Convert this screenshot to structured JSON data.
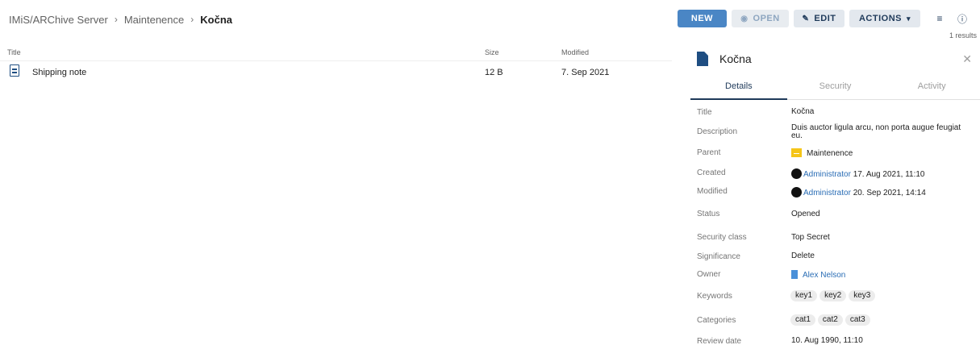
{
  "breadcrumb": {
    "items": [
      "IMiS/ARChive Server",
      "Maintenence",
      "Kočna"
    ],
    "separator": "›"
  },
  "toolbar": {
    "new_label": "NEW",
    "open_label": "OPEN",
    "edit_label": "EDIT",
    "actions_label": "ACTIONS",
    "results_text": "1 results"
  },
  "table": {
    "columns": {
      "title": "Title",
      "size": "Size",
      "modified": "Modified"
    },
    "rows": [
      {
        "title": "Shipping note",
        "size": "12 B",
        "modified": "7. Sep 2021"
      }
    ]
  },
  "panel": {
    "title": "Kočna",
    "tabs": [
      "Details",
      "Security",
      "Activity"
    ],
    "active_tab": "Details",
    "details": {
      "title_label": "Title",
      "title_value": "Kočna",
      "description_label": "Description",
      "description_value": "Duis auctor ligula arcu, non porta augue feugiat eu.",
      "parent_label": "Parent",
      "parent_value": "Maintenence",
      "created_label": "Created",
      "created_user": "Administrator",
      "created_date": "17. Aug 2021, 11:10",
      "modified_label": "Modified",
      "modified_user": "Administrator",
      "modified_date": "20. Sep 2021, 14:14",
      "status_label": "Status",
      "status_value": "Opened",
      "security_class_label": "Security class",
      "security_class_value": "Top Secret",
      "significance_label": "Significance",
      "significance_value": "Delete",
      "owner_label": "Owner",
      "owner_value": "Alex Nelson",
      "keywords_label": "Keywords",
      "keywords": [
        "key1",
        "key2",
        "key3"
      ],
      "categories_label": "Categories",
      "categories": [
        "cat1",
        "cat2",
        "cat3"
      ],
      "review_date_label": "Review date",
      "review_date_value": "10. Aug 1990, 11:10"
    }
  },
  "colors": {
    "primary": "#4a86c5",
    "navy": "#1f3a5a",
    "link": "#2a6db5",
    "folder": "#f5c518"
  }
}
